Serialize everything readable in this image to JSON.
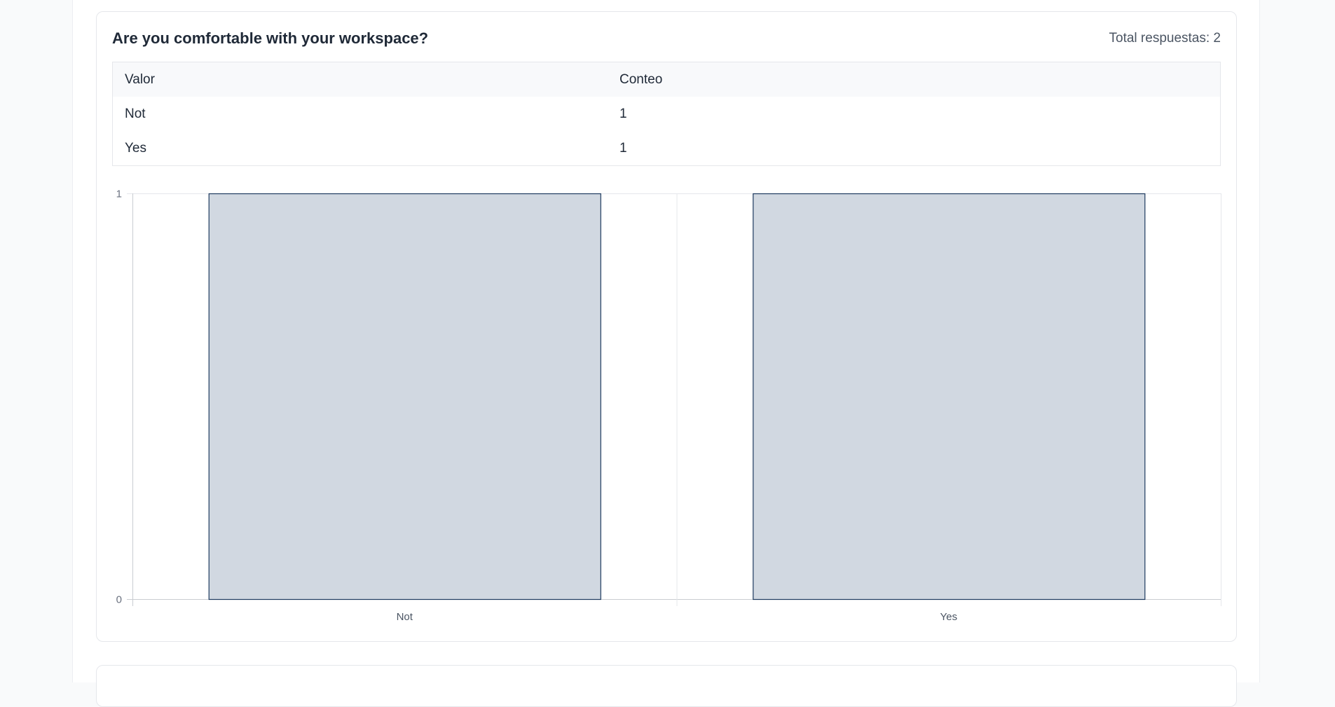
{
  "question": {
    "title": "Are you comfortable with your workspace?",
    "total_label": "Total respuestas: 2"
  },
  "table": {
    "headers": [
      "Valor",
      "Conteo"
    ],
    "rows": [
      {
        "value": "Not",
        "count": "1"
      },
      {
        "value": "Yes",
        "count": "1"
      }
    ]
  },
  "chart_data": {
    "type": "bar",
    "categories": [
      "Not",
      "Yes"
    ],
    "values": [
      1,
      1
    ],
    "ylim": [
      0,
      1
    ],
    "yticks": [
      "0",
      "1"
    ],
    "grid": true,
    "bar_fill": "#d1d8e1",
    "bar_stroke": "#1e3a5f"
  },
  "colors": {
    "text": "#1f2937",
    "muted": "#4b5563",
    "border": "#e5e7eb",
    "header_bg": "#f8f9fb"
  }
}
